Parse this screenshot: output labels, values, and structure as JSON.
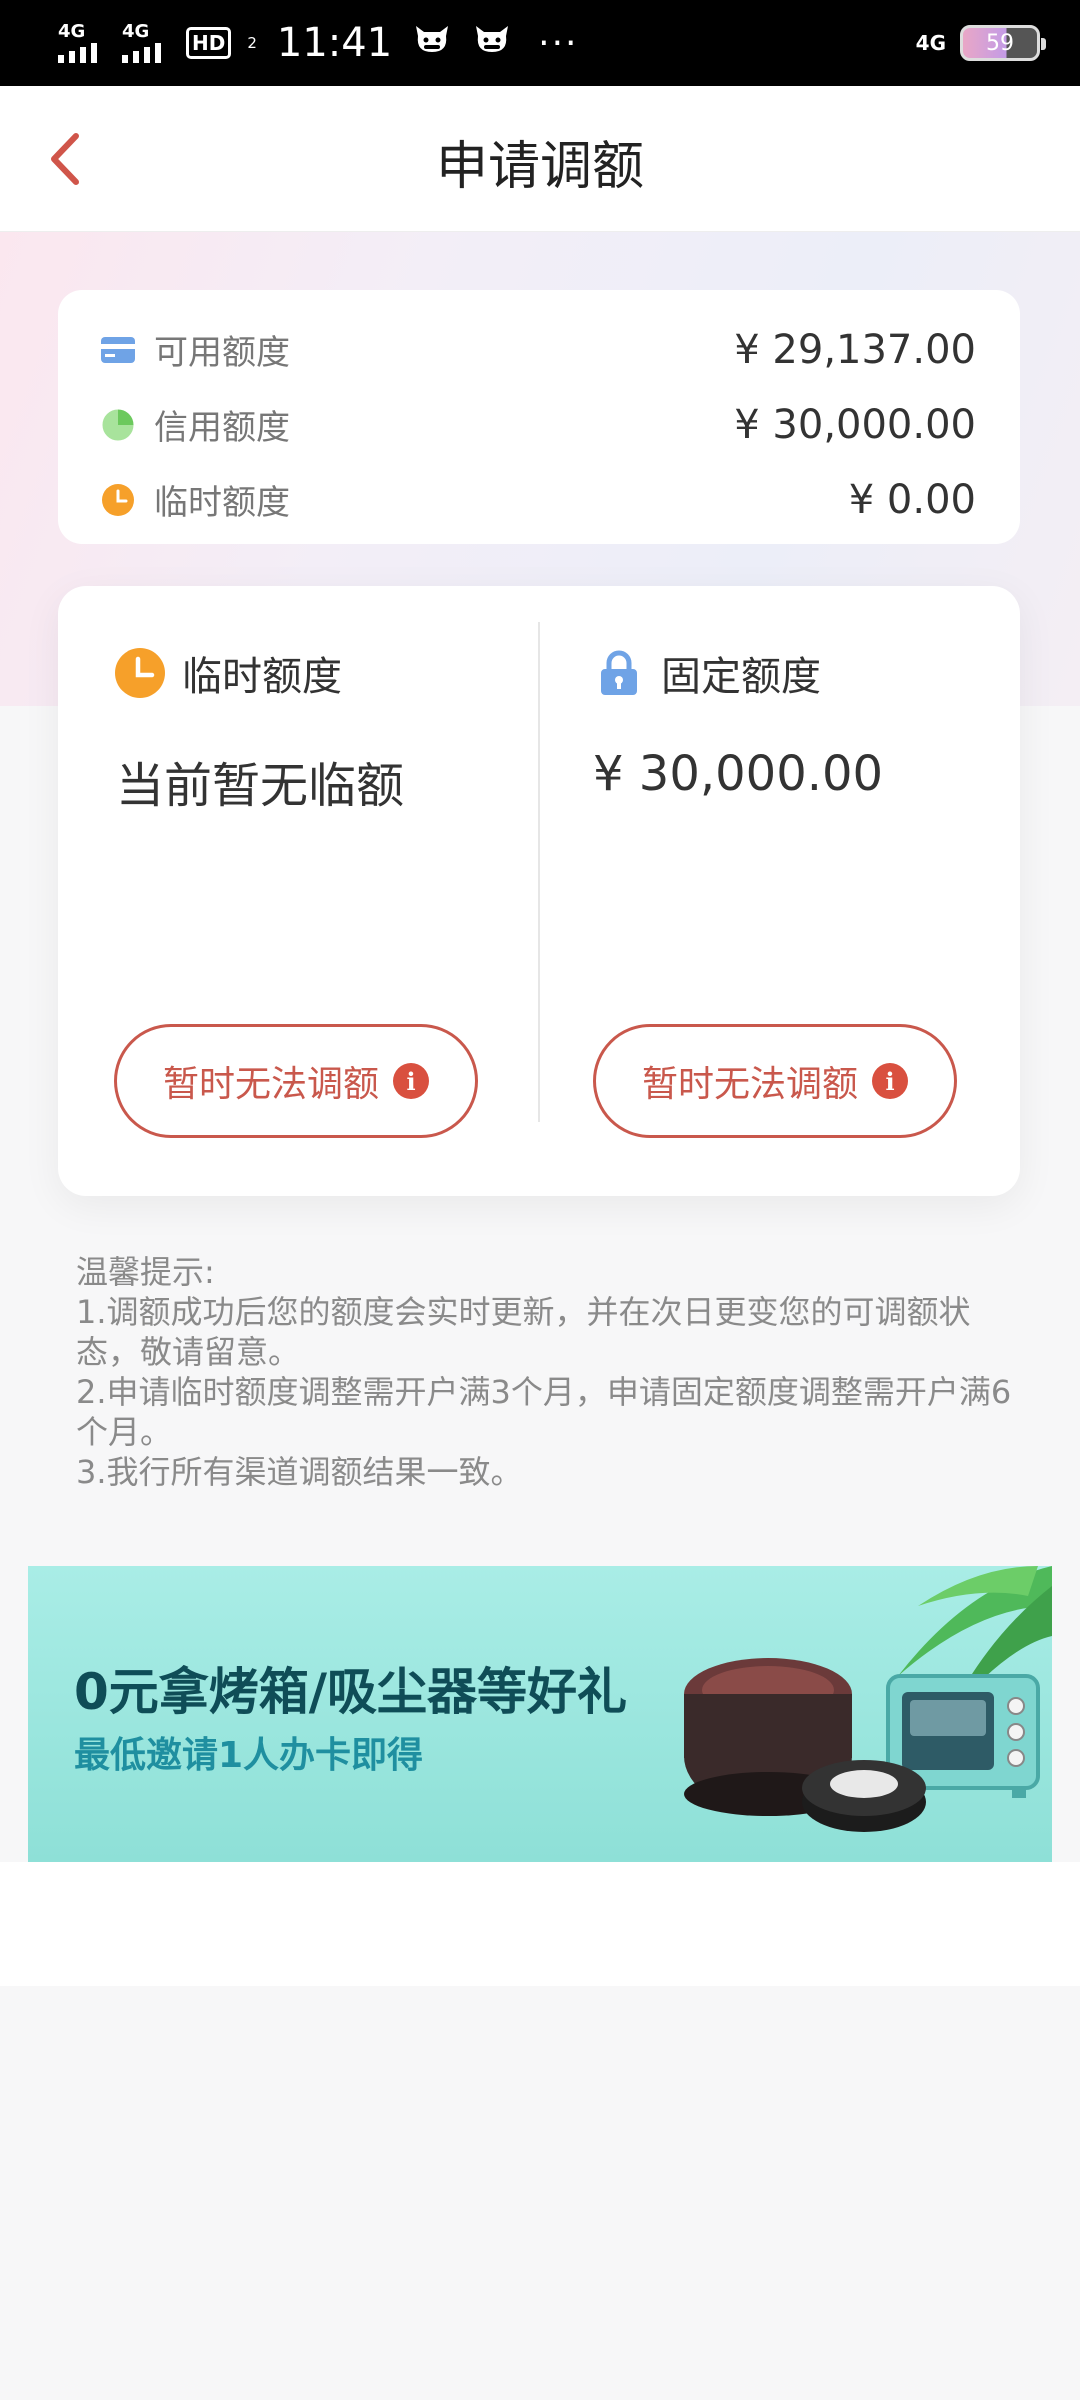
{
  "status_bar": {
    "signal1_tag": "4G",
    "signal2_tag": "4G",
    "hd_label": "HD",
    "hd_sub": "2",
    "time": "11:41",
    "more": "···",
    "network": "4G",
    "battery": "59"
  },
  "nav": {
    "title": "申请调额"
  },
  "summary": {
    "rows": [
      {
        "label": "可用额度",
        "value": "¥ 29,137.00",
        "icon": "card-icon",
        "color": "#6fa3e6"
      },
      {
        "label": "信用额度",
        "value": "¥ 30,000.00",
        "icon": "pie-icon",
        "color": "#8fda82"
      },
      {
        "label": "临时额度",
        "value": "¥ 0.00",
        "icon": "clock-icon",
        "color": "#f6a02a"
      }
    ]
  },
  "adjust": {
    "temporary": {
      "title": "临时额度",
      "value": "当前暂无临额",
      "button": "暂时无法调额",
      "icon": "clock-icon"
    },
    "fixed": {
      "title": "固定额度",
      "value": "¥ 30,000.00",
      "button": "暂时无法调额",
      "icon": "lock-icon"
    }
  },
  "tips": {
    "heading": "温馨提示:",
    "lines": [
      "1.调额成功后您的额度会实时更新，并在次日更变您的可调额状态，敬请留意。",
      "2.申请临时额度调整需开户满3个月，申请固定额度调整需开户满6个月。",
      "3.我行所有渠道调额结果一致。"
    ]
  },
  "banner": {
    "title": "0元拿烤箱/吸尘器等好礼",
    "subtitle": "最低邀请1人办卡即得"
  },
  "colors": {
    "accent": "#c9584c",
    "info": "#d9503f",
    "banner_bg": "#a9ede6"
  }
}
